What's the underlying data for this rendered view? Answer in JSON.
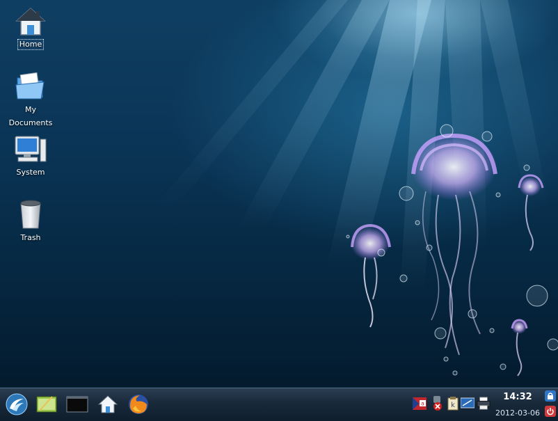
{
  "desktop": {
    "icons": [
      {
        "label": "Home",
        "icon": "home-icon"
      },
      {
        "label": "My\nDocuments",
        "icon": "folder-icon"
      },
      {
        "label": "System",
        "icon": "computer-icon"
      },
      {
        "label": "Trash",
        "icon": "trash-icon"
      }
    ],
    "labels": {
      "home": "Home",
      "documents_line1": "My",
      "documents_line2": "Documents",
      "system": "System",
      "trash": "Trash"
    }
  },
  "taskbar": {
    "launchers": [
      "kickoff-menu-icon",
      "text-editor-icon",
      "terminal-icon",
      "home-folder-icon",
      "firefox-icon"
    ],
    "tray": [
      "keyboard-layout-icon",
      "network-disconnected-icon",
      "klipper-icon",
      "display-icon",
      "printer-icon"
    ],
    "clock": {
      "time": "14:32",
      "date": "2012-03-06"
    },
    "side": [
      "lock-icon",
      "shutdown-icon"
    ]
  },
  "colors": {
    "accent": "#7ab8e6",
    "jellyfish": "#c9a3ff",
    "shutdown": "#d23b3b"
  }
}
